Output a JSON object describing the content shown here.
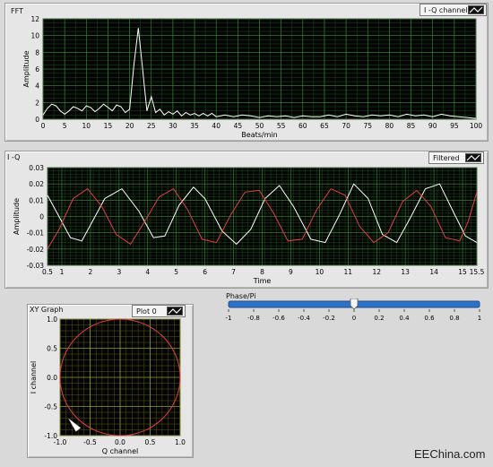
{
  "fft": {
    "title": "FFT",
    "legend": "I -Q channel",
    "chart_data": {
      "type": "line",
      "xlabel": "Beats/min",
      "ylabel": "Amplitude",
      "xlim": [
        0,
        100
      ],
      "ylim": [
        0,
        12
      ],
      "xticks": [
        0,
        5,
        10,
        15,
        20,
        25,
        30,
        35,
        40,
        45,
        50,
        55,
        60,
        65,
        70,
        75,
        80,
        85,
        90,
        95,
        100
      ],
      "yticks": [
        0,
        2,
        4,
        6,
        8,
        10,
        12
      ],
      "series": [
        {
          "name": "I -Q channel",
          "color": "#ffffff",
          "points": [
            [
              0,
              0.5
            ],
            [
              1,
              1.3
            ],
            [
              2,
              1.8
            ],
            [
              3,
              1.6
            ],
            [
              4,
              1.0
            ],
            [
              5,
              0.6
            ],
            [
              6,
              1.0
            ],
            [
              7,
              1.5
            ],
            [
              8,
              1.3
            ],
            [
              9,
              1.0
            ],
            [
              10,
              1.6
            ],
            [
              11,
              1.4
            ],
            [
              12,
              0.9
            ],
            [
              13,
              1.3
            ],
            [
              14,
              1.8
            ],
            [
              15,
              1.4
            ],
            [
              16,
              1.0
            ],
            [
              17,
              1.7
            ],
            [
              18,
              1.5
            ],
            [
              19,
              0.8
            ],
            [
              20,
              1.2
            ],
            [
              21,
              6.5
            ],
            [
              22,
              10.9
            ],
            [
              23,
              6.0
            ],
            [
              24,
              1.0
            ],
            [
              25,
              2.7
            ],
            [
              26,
              0.8
            ],
            [
              27,
              1.2
            ],
            [
              28,
              0.5
            ],
            [
              29,
              0.9
            ],
            [
              30,
              0.6
            ],
            [
              31,
              1.0
            ],
            [
              32,
              0.4
            ],
            [
              33,
              0.8
            ],
            [
              34,
              0.5
            ],
            [
              35,
              0.7
            ],
            [
              36,
              0.4
            ],
            [
              37,
              0.7
            ],
            [
              38,
              0.4
            ],
            [
              39,
              0.7
            ],
            [
              40,
              0.3
            ],
            [
              42,
              0.5
            ],
            [
              44,
              0.3
            ],
            [
              46,
              0.5
            ],
            [
              48,
              0.4
            ],
            [
              50,
              0.2
            ],
            [
              52,
              0.4
            ],
            [
              54,
              0.3
            ],
            [
              56,
              0.4
            ],
            [
              58,
              0.2
            ],
            [
              60,
              0.4
            ],
            [
              62,
              0.3
            ],
            [
              64,
              0.3
            ],
            [
              66,
              0.5
            ],
            [
              68,
              0.3
            ],
            [
              70,
              0.6
            ],
            [
              72,
              0.4
            ],
            [
              74,
              0.3
            ],
            [
              76,
              0.5
            ],
            [
              78,
              0.4
            ],
            [
              80,
              0.5
            ],
            [
              82,
              0.3
            ],
            [
              84,
              0.6
            ],
            [
              86,
              0.4
            ],
            [
              88,
              0.5
            ],
            [
              90,
              0.3
            ],
            [
              92,
              0.6
            ],
            [
              94,
              0.4
            ],
            [
              96,
              0.3
            ],
            [
              98,
              0.2
            ],
            [
              100,
              0.1
            ]
          ]
        }
      ]
    }
  },
  "iq": {
    "title": "I -Q",
    "legend": "Filtered",
    "chart_data": {
      "type": "line",
      "xlabel": "Time",
      "ylabel": "Amplitude",
      "xlim": [
        0.5,
        15.5
      ],
      "ylim": [
        -0.03,
        0.03
      ],
      "xticks": [
        "0.5",
        "1",
        "2",
        "3",
        "4",
        "5",
        "6",
        "7",
        "8",
        "9",
        "10",
        "11",
        "12",
        "13",
        "14",
        "15",
        "15.5"
      ],
      "xtick_values": [
        0.5,
        1,
        2,
        3,
        4,
        5,
        6,
        7,
        8,
        9,
        10,
        11,
        12,
        13,
        14,
        15,
        15.5
      ],
      "yticks": [
        "0.03",
        "0.02",
        "0.01",
        "0",
        "-0.01",
        "-0.02",
        "-0.03"
      ],
      "ytick_values": [
        0.03,
        0.02,
        0.01,
        0,
        -0.01,
        -0.02,
        -0.03
      ],
      "series": [
        {
          "name": "I",
          "color": "#ffffff",
          "points": [
            [
              0.5,
              0.013
            ],
            [
              0.9,
              0.0
            ],
            [
              1.3,
              -0.013
            ],
            [
              1.7,
              -0.015
            ],
            [
              2.1,
              -0.002
            ],
            [
              2.5,
              0.011
            ],
            [
              3.1,
              0.017
            ],
            [
              3.7,
              0.003
            ],
            [
              4.2,
              -0.013
            ],
            [
              4.6,
              -0.012
            ],
            [
              5.1,
              0.007
            ],
            [
              5.6,
              0.018
            ],
            [
              6.0,
              0.011
            ],
            [
              6.6,
              -0.009
            ],
            [
              7.1,
              -0.017
            ],
            [
              7.6,
              -0.008
            ],
            [
              8.1,
              0.011
            ],
            [
              8.6,
              0.019
            ],
            [
              9.1,
              0.006
            ],
            [
              9.7,
              -0.014
            ],
            [
              10.2,
              -0.016
            ],
            [
              10.7,
              0.001
            ],
            [
              11.2,
              0.02
            ],
            [
              11.7,
              0.011
            ],
            [
              12.2,
              -0.011
            ],
            [
              12.7,
              -0.016
            ],
            [
              13.2,
              0.0
            ],
            [
              13.7,
              0.017
            ],
            [
              14.2,
              0.02
            ],
            [
              14.7,
              0.002
            ],
            [
              15.1,
              -0.012
            ],
            [
              15.5,
              -0.016
            ]
          ]
        },
        {
          "name": "Q",
          "color": "#e04040",
          "points": [
            [
              0.5,
              -0.02
            ],
            [
              0.9,
              -0.008
            ],
            [
              1.4,
              0.011
            ],
            [
              1.9,
              0.017
            ],
            [
              2.4,
              0.006
            ],
            [
              2.9,
              -0.011
            ],
            [
              3.4,
              -0.017
            ],
            [
              3.9,
              -0.003
            ],
            [
              4.4,
              0.012
            ],
            [
              4.9,
              0.017
            ],
            [
              5.4,
              0.004
            ],
            [
              5.9,
              -0.014
            ],
            [
              6.4,
              -0.016
            ],
            [
              6.9,
              0.001
            ],
            [
              7.4,
              0.015
            ],
            [
              7.9,
              0.016
            ],
            [
              8.4,
              0.002
            ],
            [
              8.9,
              -0.015
            ],
            [
              9.4,
              -0.014
            ],
            [
              9.9,
              0.004
            ],
            [
              10.4,
              0.017
            ],
            [
              10.9,
              0.013
            ],
            [
              11.4,
              -0.006
            ],
            [
              11.9,
              -0.016
            ],
            [
              12.4,
              -0.01
            ],
            [
              12.9,
              0.009
            ],
            [
              13.4,
              0.016
            ],
            [
              13.9,
              0.006
            ],
            [
              14.4,
              -0.013
            ],
            [
              14.9,
              -0.015
            ],
            [
              15.2,
              -0.003
            ],
            [
              15.5,
              0.015
            ]
          ]
        }
      ]
    }
  },
  "slider": {
    "label": "Phase/Pi",
    "value": 0,
    "min": -1,
    "max": 1,
    "ticks": [
      "-1",
      "-0.8",
      "-0.6",
      "-0.4",
      "-0.2",
      "0",
      "0.2",
      "0.4",
      "0.6",
      "0.8",
      "1"
    ]
  },
  "xy": {
    "title": "XY Graph",
    "legend": "Plot 0",
    "chart_data": {
      "type": "scatter",
      "xlabel": "Q channel",
      "ylabel": "I channel",
      "xlim": [
        -1,
        1
      ],
      "ylim": [
        -1,
        1
      ],
      "xticks": [
        "-1.0",
        "-0.5",
        "0.0",
        "0.5",
        "1.0"
      ],
      "xtick_values": [
        -1,
        -0.5,
        0,
        0.5,
        1
      ],
      "yticks": [
        "1.0",
        "0.5",
        "0.0",
        "-0.5",
        "-1.0"
      ],
      "ytick_values": [
        1,
        0.5,
        0,
        -0.5,
        -1
      ],
      "circle": {
        "radius": 1,
        "color": "#e04040"
      },
      "marker": {
        "x": -0.72,
        "y": -0.82,
        "color": "#ffffff"
      }
    }
  },
  "watermark": "EEChina.com"
}
